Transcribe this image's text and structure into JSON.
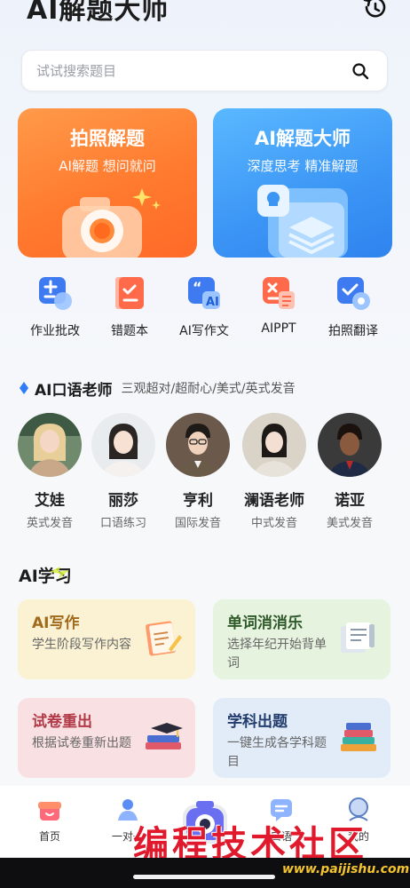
{
  "header": {
    "title": "AI解题大师",
    "history_icon": "history-icon"
  },
  "search": {
    "placeholder": "试试搜索题目",
    "value": "",
    "icon": "search-icon"
  },
  "hero_cards": [
    {
      "title": "拍照解题",
      "subtitle": "AI解题  想问就问",
      "color": "#ff7a2e"
    },
    {
      "title": "AI解题大师",
      "subtitle": "深度思考  精准解题",
      "color": "#3b95f5"
    }
  ],
  "tools": [
    {
      "label": "作业批改",
      "icon": "homework-check-icon"
    },
    {
      "label": "错题本",
      "icon": "mistake-book-icon"
    },
    {
      "label": "AI写作文",
      "icon": "ai-essay-icon"
    },
    {
      "label": "AIPPT",
      "icon": "ai-ppt-icon"
    },
    {
      "label": "拍照翻译",
      "icon": "photo-translate-icon"
    }
  ],
  "oral": {
    "title": "AI口语老师",
    "subtitle": "三观超对/超耐心/美式/英式发音",
    "teachers": [
      {
        "name": "艾娃",
        "desc": "英式发音"
      },
      {
        "name": "丽莎",
        "desc": "口语练习"
      },
      {
        "name": "亨利",
        "desc": "国际发音"
      },
      {
        "name": "澜语老师",
        "desc": "中式发音"
      },
      {
        "name": "诺亚",
        "desc": "美式发音"
      }
    ]
  },
  "study": {
    "title": "AI学习",
    "cards": [
      {
        "title": "AI写作",
        "desc": "学生阶段写作内容",
        "icon": "writing-icon"
      },
      {
        "title": "单词消消乐",
        "desc": "选择年纪开始背单词",
        "icon": "vocabulary-icon"
      },
      {
        "title": "试卷重出",
        "desc": "根据试卷重新出题",
        "icon": "exam-regenerate-icon"
      },
      {
        "title": "学科出题",
        "desc": "一键生成各学科题目",
        "icon": "subject-quiz-icon"
      }
    ]
  },
  "nav": {
    "items": [
      {
        "label": "首页",
        "icon": "home-icon"
      },
      {
        "label": "一对一",
        "icon": "tutor-icon"
      },
      {
        "label": "",
        "icon": "camera-icon"
      },
      {
        "label": "口语",
        "icon": "chat-icon"
      },
      {
        "label": "我的",
        "icon": "profile-icon"
      }
    ]
  },
  "watermark": {
    "text": "编程技术社区",
    "url": "www.paijishu.com"
  },
  "colors": {
    "accent_orange": "#ff7a2e",
    "accent_blue": "#3b95f5",
    "diamond": "#2f7df6"
  }
}
